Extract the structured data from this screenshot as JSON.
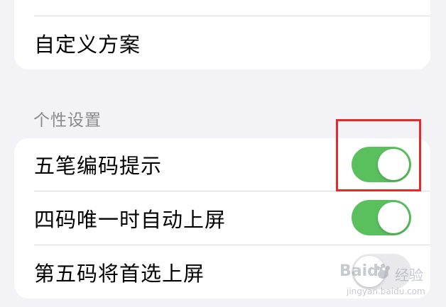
{
  "top_section": {
    "rows": [
      {
        "label": "自定义方案"
      }
    ]
  },
  "personal_section": {
    "header": "个性设置",
    "rows": [
      {
        "label": "五笔编码提示",
        "toggle": "on"
      },
      {
        "label": "四码唯一时自动上屏",
        "toggle": "on"
      },
      {
        "label": "第五码将首选上屏",
        "toggle": "off"
      }
    ]
  },
  "colors": {
    "toggle_on": "#5ac05e",
    "toggle_off": "#e9e9eb",
    "highlight": "#e8282b",
    "background": "#f2f2f7"
  },
  "watermark": {
    "brand": "Baidu",
    "label": "经验",
    "url": "jingyan.baidu.com"
  }
}
